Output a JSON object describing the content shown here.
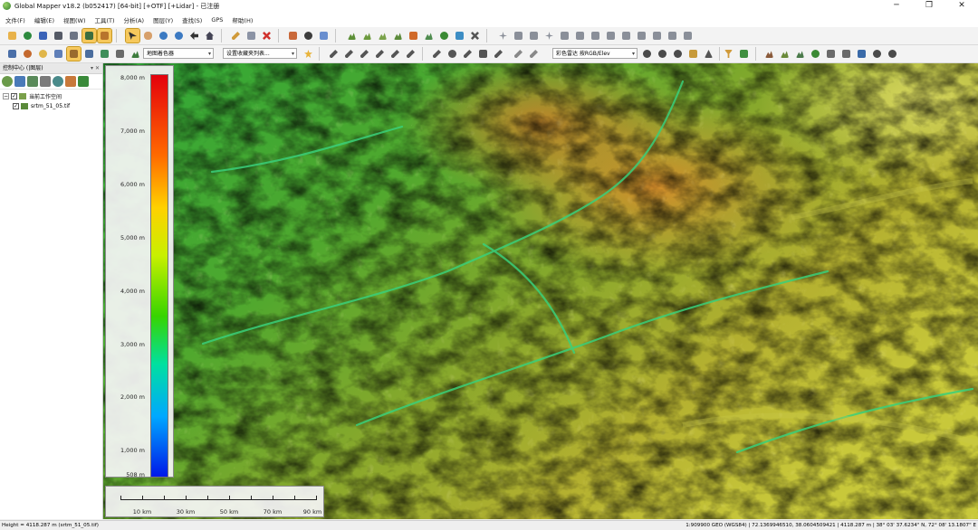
{
  "window": {
    "title": "Global Mapper v18.2 (b052417) [64-bit] [+OTF] [+Lidar] - 已注册",
    "minimize_glyph": "─",
    "restore_glyph": "❐",
    "close_glyph": "✕"
  },
  "menu": [
    "文件(F)",
    "编辑(E)",
    "视图(W)",
    "工具(T)",
    "分析(A)",
    "图层(Y)",
    "查找(S)",
    "GPS",
    "帮助(H)"
  ],
  "toolbar": {
    "shader_combo": "地图着色器",
    "favorites_combo": "设置收藏夹列表...",
    "color_mode_combo": "彩色雷达 按RGB/Elev"
  },
  "sidebar": {
    "title": "控制中心 (|图层)",
    "pin_glyph": "▾ ✕",
    "tree": [
      {
        "label": "当前工作空间",
        "checked": "✓",
        "expander": "−"
      },
      {
        "label": "srtm_51_05.tif",
        "checked": "✓"
      }
    ]
  },
  "legend": {
    "labels": [
      "8,000 m",
      "7,000 m",
      "6,000 m",
      "5,000 m",
      "4,000 m",
      "3,000 m",
      "2,000 m",
      "1,000 m",
      "508 m"
    ],
    "max_m": 8000,
    "min_m": 508
  },
  "scalebar": {
    "labels": [
      "10 km",
      "30 km",
      "50 km",
      "70 km",
      "90 km"
    ]
  },
  "status": {
    "left": "Height = 4118.287 m (srtm_51_05.tif)",
    "right": "1:909900  GEO (WGS84) | 72.1369946510, 38.0604509421 | 4118.287 m | 38° 03' 37.6234\" N, 72° 08' 13.1807\" E"
  },
  "colors": {
    "selected_tool": "#f6c85c",
    "ramp_top": "#e4000c",
    "ramp_bottom": "#0018e8"
  }
}
